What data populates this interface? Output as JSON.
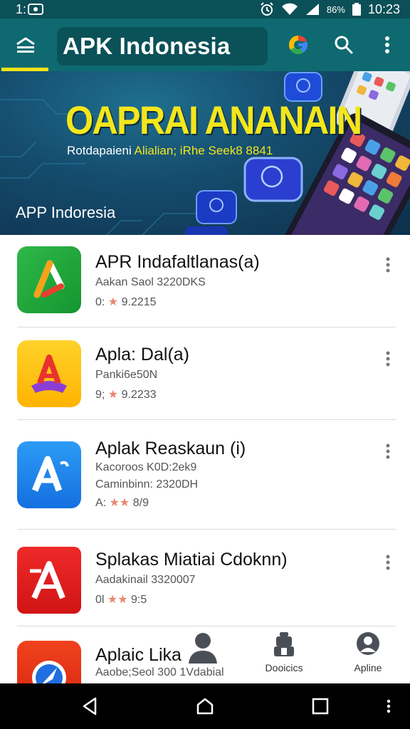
{
  "status_bar": {
    "left_text": "1:",
    "battery_percent": "86%",
    "time": "10:23"
  },
  "app_bar": {
    "title": "APK Indonesia"
  },
  "banner": {
    "title": "OAPRAI ANANAIN",
    "subtitle_white": "Rotdapaieni ",
    "subtitle_yellow": "Alialian; iRhe Seek8 ",
    "subtitle_end": "8841",
    "caption": "APP Indoresia"
  },
  "apps": [
    {
      "name": "APR Indafaltlanas(a)",
      "meta": "Aakan Saol 3220DKS",
      "meta2": "",
      "rating_prefix": "0:",
      "stars": 1,
      "rating_text": "9.2215"
    },
    {
      "name": "Apla: Dal(a)",
      "meta": "Panki6e50N",
      "meta2": "",
      "rating_prefix": "9;",
      "stars": 1,
      "rating_text": "9.2233"
    },
    {
      "name": "Aplak Reaskaun (i)",
      "meta": "Kacoroos K0D:2ek9",
      "meta2": "Caminbinn: 2320DH",
      "rating_prefix": "A:",
      "stars": 2,
      "rating_text": "8/9"
    },
    {
      "name": "Splakas Miatiai Cdoknn)",
      "meta": "Aadakinail 3320007",
      "meta2": "",
      "rating_prefix": "0l",
      "stars": 2,
      "rating_text": "9:5"
    },
    {
      "name": "Aplaic Lika",
      "meta": "Aaobe;Seol 300 1Vdabial",
      "meta2": "",
      "rating_prefix": "",
      "stars": 0,
      "rating_text": ""
    }
  ],
  "bottom_tabs": [
    {
      "label": "",
      "icon": "person-icon"
    },
    {
      "label": "Dooicics",
      "icon": "robot-icon"
    },
    {
      "label": "Apline",
      "icon": "profile-icon"
    }
  ],
  "colors": {
    "app_bar": "#0e6a70",
    "status_bar": "#0b4f57",
    "accent_yellow": "#f4e31a",
    "star": "#e8876f"
  }
}
